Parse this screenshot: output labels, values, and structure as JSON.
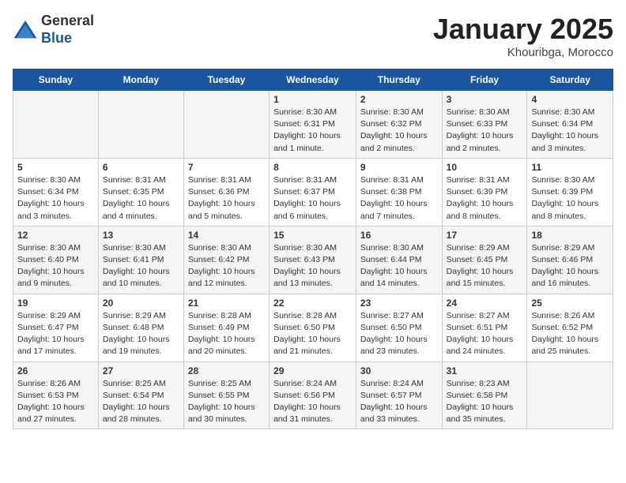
{
  "logo": {
    "general": "General",
    "blue": "Blue"
  },
  "header": {
    "month": "January 2025",
    "location": "Khouribga, Morocco"
  },
  "weekdays": [
    "Sunday",
    "Monday",
    "Tuesday",
    "Wednesday",
    "Thursday",
    "Friday",
    "Saturday"
  ],
  "weeks": [
    [
      null,
      null,
      null,
      {
        "day": "1",
        "sunrise": "8:30 AM",
        "sunset": "6:31 PM",
        "daylight": "10 hours and 1 minute."
      },
      {
        "day": "2",
        "sunrise": "8:30 AM",
        "sunset": "6:32 PM",
        "daylight": "10 hours and 2 minutes."
      },
      {
        "day": "3",
        "sunrise": "8:30 AM",
        "sunset": "6:33 PM",
        "daylight": "10 hours and 2 minutes."
      },
      {
        "day": "4",
        "sunrise": "8:30 AM",
        "sunset": "6:34 PM",
        "daylight": "10 hours and 3 minutes."
      }
    ],
    [
      {
        "day": "5",
        "sunrise": "8:30 AM",
        "sunset": "6:34 PM",
        "daylight": "10 hours and 3 minutes."
      },
      {
        "day": "6",
        "sunrise": "8:31 AM",
        "sunset": "6:35 PM",
        "daylight": "10 hours and 4 minutes."
      },
      {
        "day": "7",
        "sunrise": "8:31 AM",
        "sunset": "6:36 PM",
        "daylight": "10 hours and 5 minutes."
      },
      {
        "day": "8",
        "sunrise": "8:31 AM",
        "sunset": "6:37 PM",
        "daylight": "10 hours and 6 minutes."
      },
      {
        "day": "9",
        "sunrise": "8:31 AM",
        "sunset": "6:38 PM",
        "daylight": "10 hours and 7 minutes."
      },
      {
        "day": "10",
        "sunrise": "8:31 AM",
        "sunset": "6:39 PM",
        "daylight": "10 hours and 8 minutes."
      },
      {
        "day": "11",
        "sunrise": "8:30 AM",
        "sunset": "6:39 PM",
        "daylight": "10 hours and 8 minutes."
      }
    ],
    [
      {
        "day": "12",
        "sunrise": "8:30 AM",
        "sunset": "6:40 PM",
        "daylight": "10 hours and 9 minutes."
      },
      {
        "day": "13",
        "sunrise": "8:30 AM",
        "sunset": "6:41 PM",
        "daylight": "10 hours and 10 minutes."
      },
      {
        "day": "14",
        "sunrise": "8:30 AM",
        "sunset": "6:42 PM",
        "daylight": "10 hours and 12 minutes."
      },
      {
        "day": "15",
        "sunrise": "8:30 AM",
        "sunset": "6:43 PM",
        "daylight": "10 hours and 13 minutes."
      },
      {
        "day": "16",
        "sunrise": "8:30 AM",
        "sunset": "6:44 PM",
        "daylight": "10 hours and 14 minutes."
      },
      {
        "day": "17",
        "sunrise": "8:29 AM",
        "sunset": "6:45 PM",
        "daylight": "10 hours and 15 minutes."
      },
      {
        "day": "18",
        "sunrise": "8:29 AM",
        "sunset": "6:46 PM",
        "daylight": "10 hours and 16 minutes."
      }
    ],
    [
      {
        "day": "19",
        "sunrise": "8:29 AM",
        "sunset": "6:47 PM",
        "daylight": "10 hours and 17 minutes."
      },
      {
        "day": "20",
        "sunrise": "8:29 AM",
        "sunset": "6:48 PM",
        "daylight": "10 hours and 19 minutes."
      },
      {
        "day": "21",
        "sunrise": "8:28 AM",
        "sunset": "6:49 PM",
        "daylight": "10 hours and 20 minutes."
      },
      {
        "day": "22",
        "sunrise": "8:28 AM",
        "sunset": "6:50 PM",
        "daylight": "10 hours and 21 minutes."
      },
      {
        "day": "23",
        "sunrise": "8:27 AM",
        "sunset": "6:50 PM",
        "daylight": "10 hours and 23 minutes."
      },
      {
        "day": "24",
        "sunrise": "8:27 AM",
        "sunset": "6:51 PM",
        "daylight": "10 hours and 24 minutes."
      },
      {
        "day": "25",
        "sunrise": "8:26 AM",
        "sunset": "6:52 PM",
        "daylight": "10 hours and 25 minutes."
      }
    ],
    [
      {
        "day": "26",
        "sunrise": "8:26 AM",
        "sunset": "6:53 PM",
        "daylight": "10 hours and 27 minutes."
      },
      {
        "day": "27",
        "sunrise": "8:25 AM",
        "sunset": "6:54 PM",
        "daylight": "10 hours and 28 minutes."
      },
      {
        "day": "28",
        "sunrise": "8:25 AM",
        "sunset": "6:55 PM",
        "daylight": "10 hours and 30 minutes."
      },
      {
        "day": "29",
        "sunrise": "8:24 AM",
        "sunset": "6:56 PM",
        "daylight": "10 hours and 31 minutes."
      },
      {
        "day": "30",
        "sunrise": "8:24 AM",
        "sunset": "6:57 PM",
        "daylight": "10 hours and 33 minutes."
      },
      {
        "day": "31",
        "sunrise": "8:23 AM",
        "sunset": "6:58 PM",
        "daylight": "10 hours and 35 minutes."
      },
      null
    ]
  ],
  "labels": {
    "sunrise": "Sunrise:",
    "sunset": "Sunset:",
    "daylight": "Daylight:"
  }
}
